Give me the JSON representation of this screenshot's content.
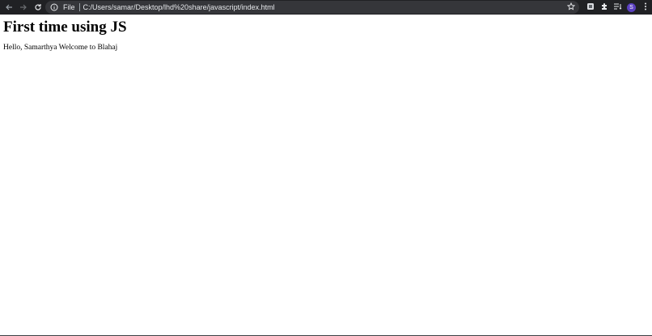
{
  "browser": {
    "address_bar": {
      "scheme_label": "File",
      "url": "C:/Users/samar/Desktop/lhd%20share/javascript/index.html"
    },
    "profile_initial": "S",
    "colors": {
      "toolbar_bg": "#202124",
      "address_bg": "#35363a",
      "avatar_bg": "#5a3fc0"
    },
    "icons": [
      "back-arrow-icon",
      "forward-arrow-icon",
      "reload-icon",
      "info-icon",
      "star-icon",
      "extension-square-icon",
      "puzzle-icon",
      "reading-list-icon",
      "avatar",
      "more-vert-icon"
    ]
  },
  "page": {
    "heading": "First time using JS",
    "message": "Hello, Samarthya Welcome to Blahaj"
  }
}
